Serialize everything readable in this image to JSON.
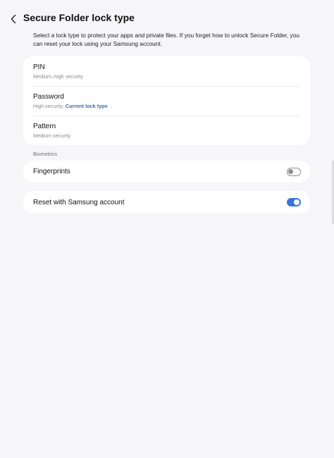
{
  "header": {
    "title": "Secure Folder lock type"
  },
  "description": "Select a lock type to protect your apps and private files. If you forget how to unlock Secure Folder, you can reset your lock using your Samsung account.",
  "lock_types": [
    {
      "title": "PIN",
      "subtitle": "Medium–high security",
      "subtitle_accent": ""
    },
    {
      "title": "Password",
      "subtitle": "High security, ",
      "subtitle_accent": "Current lock type"
    },
    {
      "title": "Pattern",
      "subtitle": "Medium security",
      "subtitle_accent": ""
    }
  ],
  "biometrics": {
    "section_label": "Biometrics",
    "fingerprints_label": "Fingerprints",
    "fingerprints_enabled": false
  },
  "reset": {
    "label": "Reset with Samsung account",
    "enabled": true
  },
  "colors": {
    "accent_text": "#3c6fa8",
    "toggle_on": "#3e72e0",
    "background": "#f6f6f8",
    "card": "#ffffff"
  }
}
